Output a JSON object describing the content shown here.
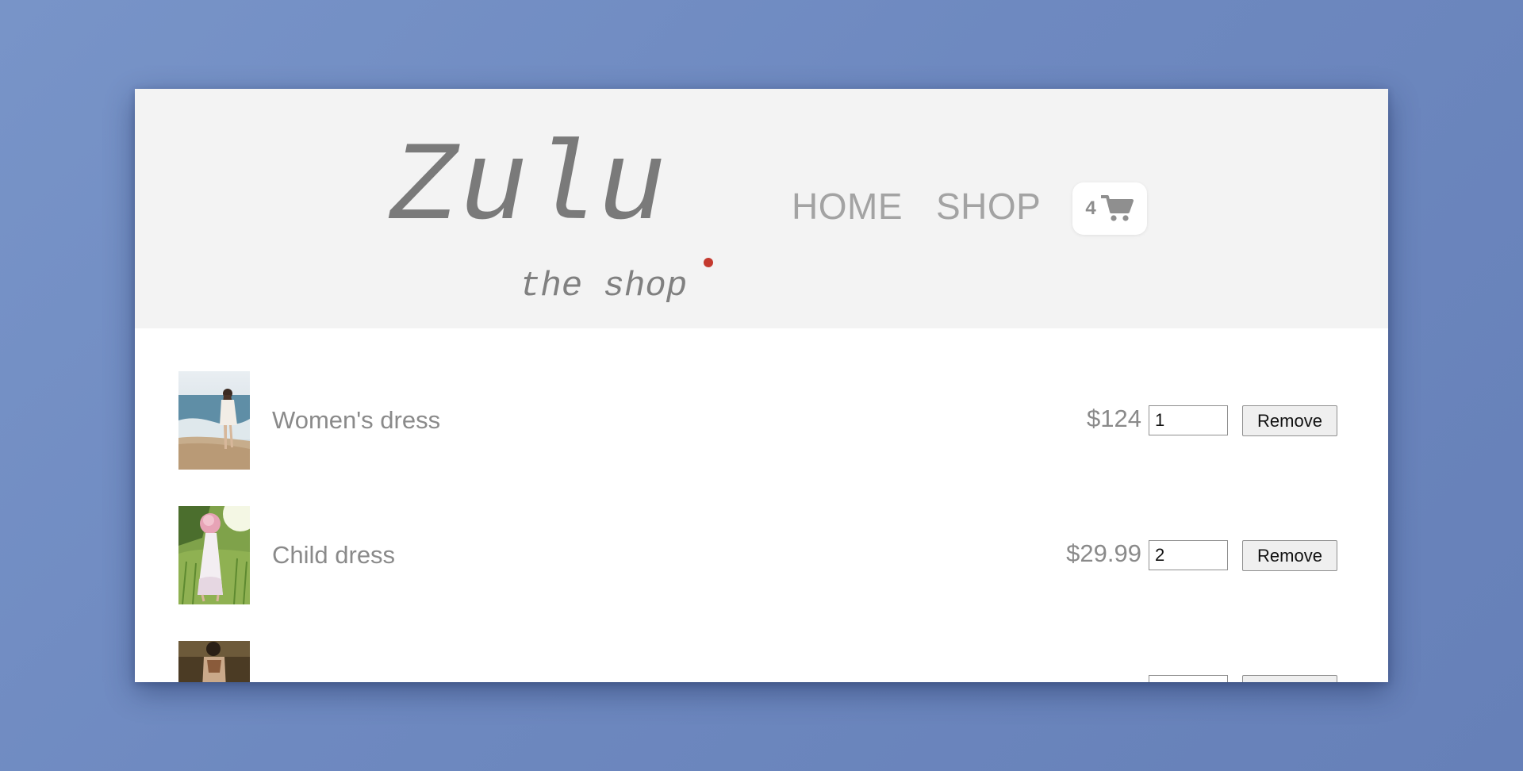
{
  "logo": {
    "main": "Zulu",
    "dot": ".",
    "tagline": "the shop",
    "dot_color": "#c4392e"
  },
  "nav": {
    "items": [
      {
        "label": "HOME"
      },
      {
        "label": "SHOP"
      }
    ]
  },
  "cart": {
    "count": "4",
    "icon": "shopping-cart-icon"
  },
  "cart_items": [
    {
      "name": "Women's dress",
      "price": "$124",
      "quantity": "1",
      "remove_label": "Remove"
    },
    {
      "name": "Child dress",
      "price": "$29.99",
      "quantity": "2",
      "remove_label": "Remove"
    },
    {
      "name": "",
      "price": "",
      "quantity": "",
      "remove_label": ""
    }
  ],
  "colors": {
    "background": "#7089c0",
    "header": "#f3f3f3",
    "accent": "#c4392e",
    "text": "#8a8a8a"
  }
}
